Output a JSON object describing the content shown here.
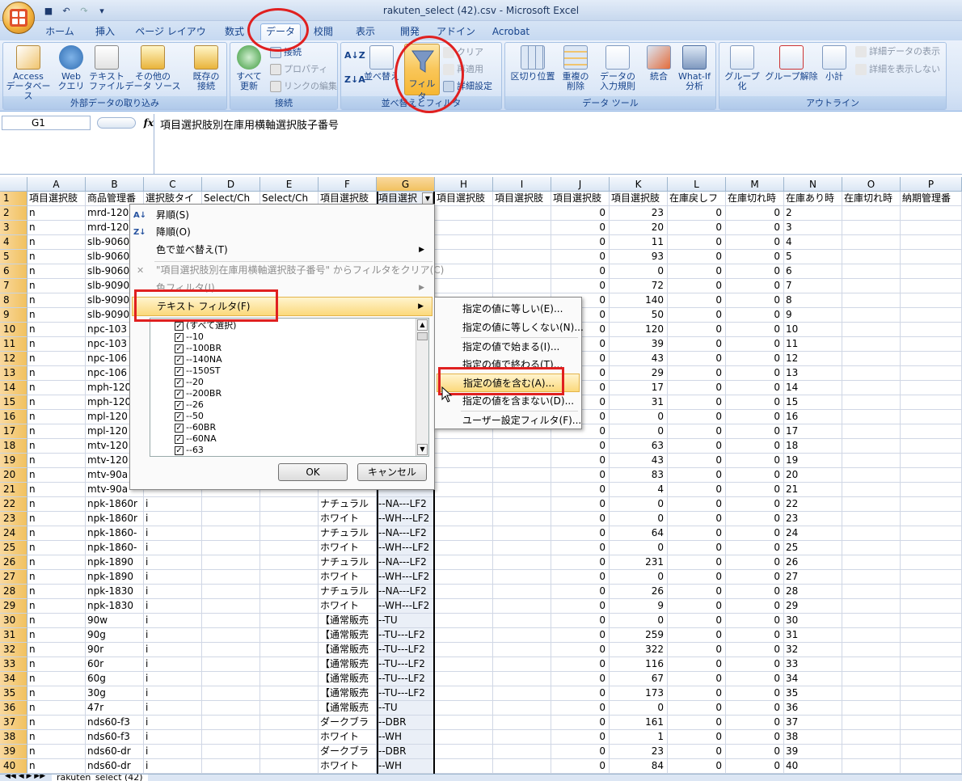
{
  "app": {
    "title": "rakuten_select (42).csv - Microsoft Excel"
  },
  "ribbon_tabs": [
    "ホーム",
    "挿入",
    "ページ レイアウト",
    "数式",
    "データ",
    "校閲",
    "表示",
    "開発",
    "アドイン",
    "Acrobat"
  ],
  "ribbon": {
    "ext_data": {
      "label": "外部データの取り込み",
      "access": [
        "Access",
        "データベース"
      ],
      "web": [
        "Web",
        "クエリ"
      ],
      "text": [
        "テキスト",
        "ファイル"
      ],
      "other": [
        "その他の",
        "データ ソース"
      ],
      "existing": [
        "既存の",
        "接続"
      ]
    },
    "connections": {
      "label": "接続",
      "refresh": [
        "すべて",
        "更新"
      ],
      "conn": "接続",
      "props": "プロパティ",
      "edit_links": "リンクの編集"
    },
    "sort_filter": {
      "label": "並べ替えとフィルタ",
      "sort": "並べ替え",
      "filter": "フィルタ",
      "clear": "クリア",
      "reapply": "再適用",
      "advanced": "詳細設定"
    },
    "data_tools": {
      "label": "データ ツール",
      "split": "区切り位置",
      "dup": [
        "重複の",
        "削除"
      ],
      "validate": [
        "データの",
        "入力規則"
      ],
      "consolidate": "統合",
      "whatif": [
        "What-If",
        "分析"
      ]
    },
    "outline": {
      "label": "アウトライン",
      "group": "グループ化",
      "ungroup": "グループ解除",
      "subtotal": "小計",
      "show": "詳細データの表示",
      "hide": "詳細を表示しない"
    }
  },
  "formula_bar": {
    "name_box": "G1",
    "fx": "fx",
    "content": "項目選択肢別在庫用横軸選択肢子番号"
  },
  "columns": [
    "A",
    "B",
    "C",
    "D",
    "E",
    "F",
    "G",
    "H",
    "I",
    "J",
    "K",
    "L",
    "M",
    "N",
    "O",
    "P"
  ],
  "header_row": [
    "項目選択肢",
    "商品管理番",
    "選択肢タイ",
    "Select/Ch",
    "Select/Ch",
    "項目選択肢",
    "項目選択",
    "項目選択肢",
    "項目選択肢",
    "項目選択肢",
    "項目選択肢",
    "在庫戻しフ",
    "在庫切れ時",
    "在庫あり時",
    "在庫切れ時",
    "納期管理番"
  ],
  "rows": [
    {
      "n": "2",
      "a": "n",
      "b": "mrd-120",
      "f": "",
      "g": "",
      "j": "0",
      "k": "23",
      "l": "0",
      "m": "0"
    },
    {
      "n": "3",
      "a": "n",
      "b": "mrd-120",
      "f": "",
      "g": "",
      "j": "0",
      "k": "20",
      "l": "0",
      "m": "0"
    },
    {
      "n": "4",
      "a": "n",
      "b": "slb-9060",
      "f": "",
      "g": "",
      "j": "0",
      "k": "11",
      "l": "0",
      "m": "0"
    },
    {
      "n": "5",
      "a": "n",
      "b": "slb-9060",
      "f": "",
      "g": "",
      "j": "0",
      "k": "93",
      "l": "0",
      "m": "0"
    },
    {
      "n": "6",
      "a": "n",
      "b": "slb-9060",
      "f": "",
      "g": "",
      "j": "0",
      "k": "0",
      "l": "0",
      "m": "0"
    },
    {
      "n": "7",
      "a": "n",
      "b": "slb-9090",
      "f": "",
      "g": "",
      "j": "0",
      "k": "72",
      "l": "0",
      "m": "0"
    },
    {
      "n": "8",
      "a": "n",
      "b": "slb-9090",
      "f": "",
      "g": "",
      "j": "0",
      "k": "140",
      "l": "0",
      "m": "0"
    },
    {
      "n": "9",
      "a": "n",
      "b": "slb-9090",
      "f": "",
      "g": "",
      "j": "0",
      "k": "50",
      "l": "0",
      "m": "0"
    },
    {
      "n": "10",
      "a": "n",
      "b": "npc-103",
      "f": "",
      "g": "",
      "j": "0",
      "k": "120",
      "l": "0",
      "m": "0"
    },
    {
      "n": "11",
      "a": "n",
      "b": "npc-103",
      "f": "",
      "g": "",
      "j": "0",
      "k": "39",
      "l": "0",
      "m": "0"
    },
    {
      "n": "12",
      "a": "n",
      "b": "npc-106",
      "f": "",
      "g": "",
      "j": "0",
      "k": "43",
      "l": "0",
      "m": "0"
    },
    {
      "n": "13",
      "a": "n",
      "b": "npc-106",
      "f": "",
      "g": "",
      "j": "0",
      "k": "29",
      "l": "0",
      "m": "0"
    },
    {
      "n": "14",
      "a": "n",
      "b": "mph-120",
      "f": "",
      "g": "",
      "j": "0",
      "k": "17",
      "l": "0",
      "m": "0"
    },
    {
      "n": "15",
      "a": "n",
      "b": "mph-120",
      "f": "",
      "g": "",
      "j": "0",
      "k": "31",
      "l": "0",
      "m": "0"
    },
    {
      "n": "16",
      "a": "n",
      "b": "mpl-120",
      "f": "",
      "g": "",
      "j": "0",
      "k": "0",
      "l": "0",
      "m": "0"
    },
    {
      "n": "17",
      "a": "n",
      "b": "mpl-120",
      "f": "",
      "g": "",
      "j": "0",
      "k": "0",
      "l": "0",
      "m": "0"
    },
    {
      "n": "18",
      "a": "n",
      "b": "mtv-120",
      "f": "",
      "g": "",
      "j": "0",
      "k": "63",
      "l": "0",
      "m": "0"
    },
    {
      "n": "19",
      "a": "n",
      "b": "mtv-120",
      "f": "",
      "g": "",
      "j": "0",
      "k": "43",
      "l": "0",
      "m": "0"
    },
    {
      "n": "20",
      "a": "n",
      "b": "mtv-90a",
      "f": "",
      "g": "",
      "j": "0",
      "k": "83",
      "l": "0",
      "m": "0"
    },
    {
      "n": "21",
      "a": "n",
      "b": "mtv-90a",
      "f": "",
      "g": "",
      "j": "0",
      "k": "4",
      "l": "0",
      "m": "0"
    },
    {
      "n": "22",
      "a": "n",
      "b": "npk-1860r",
      "c": "i",
      "f": "ナチュラル",
      "g": "--NA---LF2",
      "j": "0",
      "k": "0",
      "l": "0",
      "m": "0"
    },
    {
      "n": "23",
      "a": "n",
      "b": "npk-1860r",
      "c": "i",
      "f": "ホワイト",
      "g": "--WH---LF2",
      "j": "0",
      "k": "0",
      "l": "0",
      "m": "0"
    },
    {
      "n": "24",
      "a": "n",
      "b": "npk-1860-",
      "c": "i",
      "f": "ナチュラル",
      "g": "--NA---LF2",
      "j": "0",
      "k": "64",
      "l": "0",
      "m": "0"
    },
    {
      "n": "25",
      "a": "n",
      "b": "npk-1860-",
      "c": "i",
      "f": "ホワイト",
      "g": "--WH---LF2",
      "j": "0",
      "k": "0",
      "l": "0",
      "m": "0"
    },
    {
      "n": "26",
      "a": "n",
      "b": "npk-1890",
      "c": "i",
      "f": "ナチュラル",
      "g": "--NA---LF2",
      "j": "0",
      "k": "231",
      "l": "0",
      "m": "0"
    },
    {
      "n": "27",
      "a": "n",
      "b": "npk-1890",
      "c": "i",
      "f": "ホワイト",
      "g": "--WH---LF2",
      "j": "0",
      "k": "0",
      "l": "0",
      "m": "0"
    },
    {
      "n": "28",
      "a": "n",
      "b": "npk-1830",
      "c": "i",
      "f": "ナチュラル",
      "g": "--NA---LF2",
      "j": "0",
      "k": "26",
      "l": "0",
      "m": "0"
    },
    {
      "n": "29",
      "a": "n",
      "b": "npk-1830",
      "c": "i",
      "f": "ホワイト",
      "g": "--WH---LF2",
      "j": "0",
      "k": "9",
      "l": "0",
      "m": "0"
    },
    {
      "n": "30",
      "a": "n",
      "b": "90w",
      "c": "i",
      "f": "【通常販売",
      "g": "--TU",
      "j": "0",
      "k": "0",
      "l": "0",
      "m": "0"
    },
    {
      "n": "31",
      "a": "n",
      "b": "90g",
      "c": "i",
      "f": "【通常販売",
      "g": "--TU---LF2",
      "j": "0",
      "k": "259",
      "l": "0",
      "m": "0"
    },
    {
      "n": "32",
      "a": "n",
      "b": "90r",
      "c": "i",
      "f": "【通常販売",
      "g": "--TU---LF2",
      "j": "0",
      "k": "322",
      "l": "0",
      "m": "0"
    },
    {
      "n": "33",
      "a": "n",
      "b": "60r",
      "c": "i",
      "f": "【通常販売",
      "g": "--TU---LF2",
      "j": "0",
      "k": "116",
      "l": "0",
      "m": "0"
    },
    {
      "n": "34",
      "a": "n",
      "b": "60g",
      "c": "i",
      "f": "【通常販売",
      "g": "--TU---LF2",
      "j": "0",
      "k": "67",
      "l": "0",
      "m": "0"
    },
    {
      "n": "35",
      "a": "n",
      "b": "30g",
      "c": "i",
      "f": "【通常販売",
      "g": "--TU---LF2",
      "j": "0",
      "k": "173",
      "l": "0",
      "m": "0"
    },
    {
      "n": "36",
      "a": "n",
      "b": "47r",
      "c": "i",
      "f": "【通常販売",
      "g": "--TU",
      "j": "0",
      "k": "0",
      "l": "0",
      "m": "0"
    },
    {
      "n": "37",
      "a": "n",
      "b": "nds60-f3",
      "c": "i",
      "f": "ダークブラ",
      "g": "--DBR",
      "j": "0",
      "k": "161",
      "l": "0",
      "m": "0"
    },
    {
      "n": "38",
      "a": "n",
      "b": "nds60-f3",
      "c": "i",
      "f": "ホワイト",
      "g": "--WH",
      "j": "0",
      "k": "1",
      "l": "0",
      "m": "0"
    },
    {
      "n": "39",
      "a": "n",
      "b": "nds60-dr",
      "c": "i",
      "f": "ダークブラ",
      "g": "--DBR",
      "j": "0",
      "k": "23",
      "l": "0",
      "m": "0"
    },
    {
      "n": "40",
      "a": "n",
      "b": "nds60-dr",
      "c": "i",
      "f": "ホワイト",
      "g": "--WH",
      "j": "0",
      "k": "84",
      "l": "0",
      "m": "0"
    }
  ],
  "filter_menu": {
    "sort_asc": "昇順(S)",
    "sort_desc": "降順(O)",
    "sort_color": "色で並べ替え(T)",
    "clear": "\"項目選択肢別在庫用横軸選択肢子番号\" からフィルタをクリア(C)",
    "color_filter": "色フィルタ(I)",
    "text_filter": "テキスト フィルタ(F)",
    "checklist": [
      "(すべて選択)",
      "--10",
      "--100BR",
      "--140NA",
      "--150ST",
      "--20",
      "--200BR",
      "--26",
      "--50",
      "--60BR",
      "--60NA",
      "--63"
    ],
    "ok": "OK",
    "cancel": "キャンセル"
  },
  "text_filter_submenu": [
    "指定の値に等しい(E)...",
    "指定の値に等しくない(N)...",
    "指定の値で始まる(I)...",
    "指定の値で終わる(T)...",
    "指定の値を含む(A)...",
    "指定の値を含まない(D)...",
    "ユーザー設定フィルタ(F)..."
  ],
  "sheet_tab": "rakuten_select (42)",
  "partial_row_21_f": "ダークブラ",
  "partial_row_21_g": "--DBR"
}
